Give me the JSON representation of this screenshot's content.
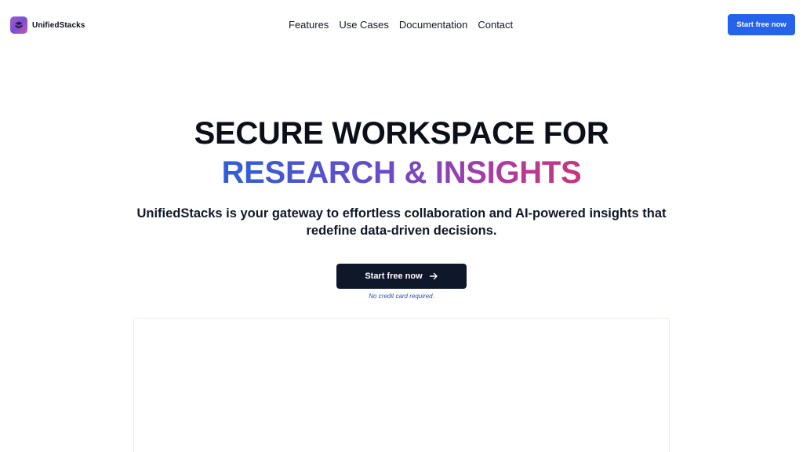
{
  "brand": {
    "name": "UnifiedStacks"
  },
  "nav": {
    "links": [
      "Features",
      "Use Cases",
      "Documentation",
      "Contact"
    ],
    "cta_label": "Start free now"
  },
  "hero": {
    "line1": "SECURE WORKSPACE FOR",
    "line2": "RESEARCH & INSIGHTS",
    "subtitle": "UnifiedStacks is your gateway to effortless collaboration and AI-powered insights that redefine data-driven decisions.",
    "cta_label": "Start free now",
    "note": "No credit card required."
  },
  "icons": {
    "logo": "stack-icon",
    "cta_arrow": "arrow-right-icon"
  },
  "colors": {
    "primary_blue": "#2563eb",
    "dark_button": "#0f172a",
    "gradient_start": "#2f5fd6",
    "gradient_end": "#c8357c",
    "logo_purple": "#a35bd6"
  }
}
